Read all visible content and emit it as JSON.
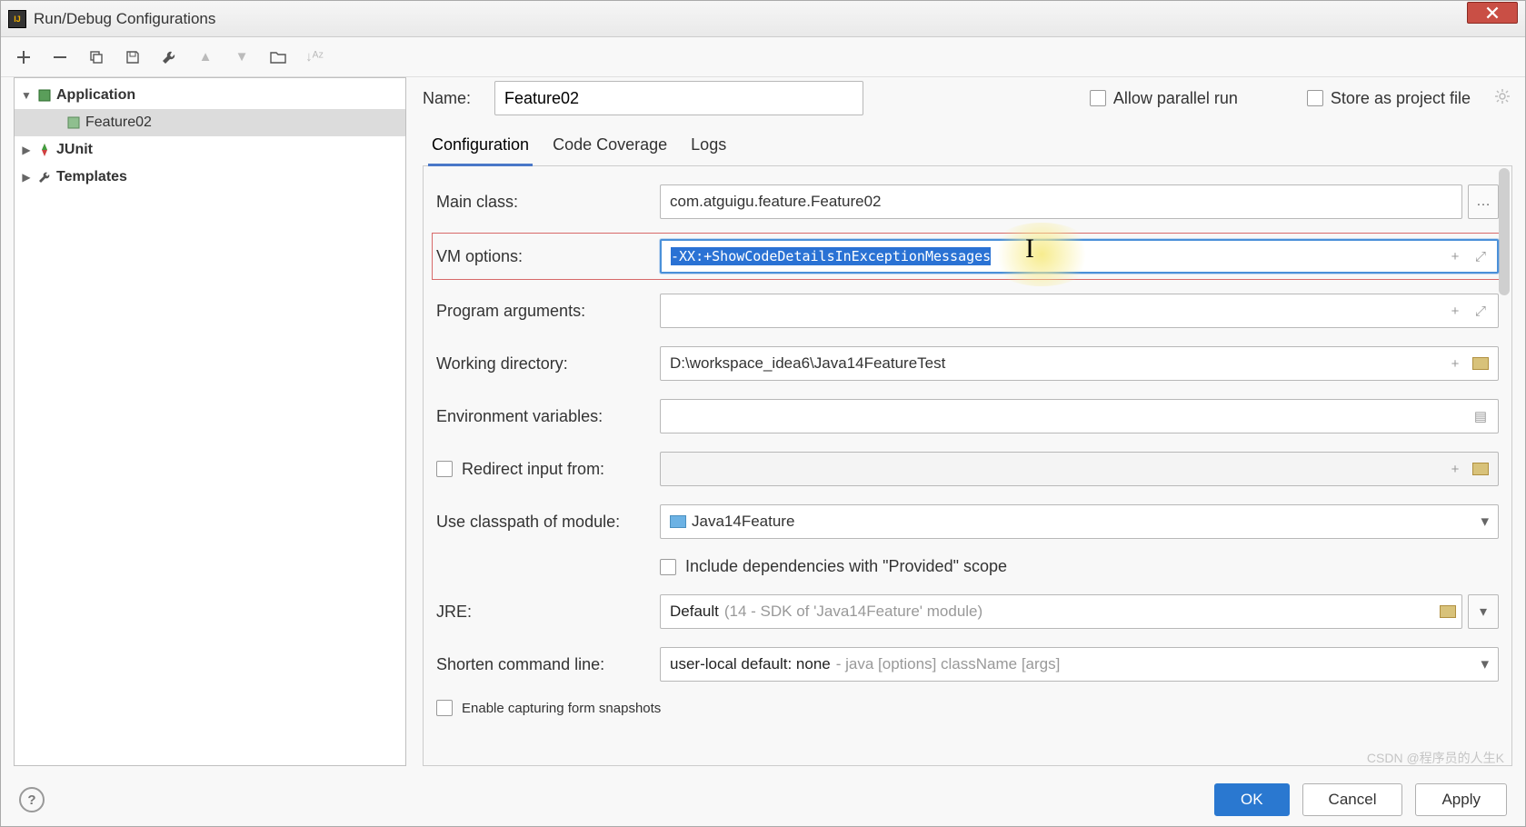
{
  "window": {
    "title": "Run/Debug Configurations"
  },
  "tree": {
    "root": "Application",
    "child": "Feature02",
    "junit": "JUnit",
    "templates": "Templates"
  },
  "header": {
    "name_label": "Name:",
    "name_value": "Feature02",
    "allow_parallel": "Allow parallel run",
    "store_project": "Store as project file"
  },
  "tabs": {
    "configuration": "Configuration",
    "coverage": "Code Coverage",
    "logs": "Logs"
  },
  "form": {
    "main_class_label": "Main class:",
    "main_class_value": "com.atguigu.feature.Feature02",
    "vm_label": "VM options:",
    "vm_value": "-XX:+ShowCodeDetailsInExceptionMessages",
    "prog_args_label": "Program arguments:",
    "prog_args_value": "",
    "workdir_label": "Working directory:",
    "workdir_value": "D:\\workspace_idea6\\Java14FeatureTest",
    "env_label": "Environment variables:",
    "env_value": "",
    "redirect_label": "Redirect input from:",
    "redirect_value": "",
    "classpath_label": "Use classpath of module:",
    "classpath_value": "Java14Feature",
    "include_provided": "Include dependencies with \"Provided\" scope",
    "jre_label": "JRE:",
    "jre_prefix": "Default",
    "jre_hint": "(14 - SDK of 'Java14Feature' module)",
    "shorten_label": "Shorten command line:",
    "shorten_prefix": "user-local default: none",
    "shorten_hint": "- java [options] className [args]",
    "enable_snapshots": "Enable capturing form snapshots"
  },
  "buttons": {
    "ok": "OK",
    "cancel": "Cancel",
    "apply": "Apply"
  },
  "watermark": "CSDN @程序员的人生K"
}
